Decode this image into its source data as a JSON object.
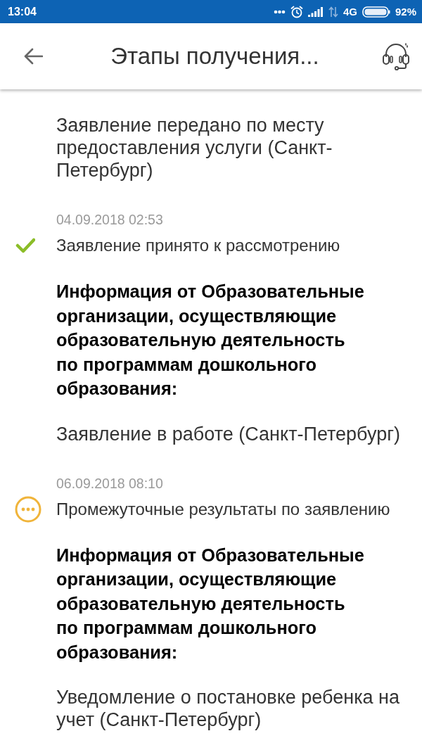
{
  "status_bar": {
    "time": "13:04",
    "network": "4G",
    "battery": "92%"
  },
  "header": {
    "title": "Этапы получения..."
  },
  "stages": [
    {
      "message": "Заявление передано по месту предоставления услуги (Санкт-Петербург)"
    },
    {
      "date": "04.09.2018 02:53",
      "kind": "done",
      "title": "Заявление принято к рассмотрению",
      "source": "Информация от Образовательные организации, осуществляющие образовательную деятельность по программам дошкольного образования:",
      "message": "Заявление в работе (Санкт-Петербург)"
    },
    {
      "date": "06.09.2018 08:10",
      "kind": "pending",
      "title": "Промежуточные результаты по заявлению",
      "source": "Информация от Образовательные организации, осуществляющие образовательную деятельность по программам дошкольного образования:",
      "message": "Уведомление о постановке ребенка на учет (Санкт-Петербург)"
    }
  ]
}
